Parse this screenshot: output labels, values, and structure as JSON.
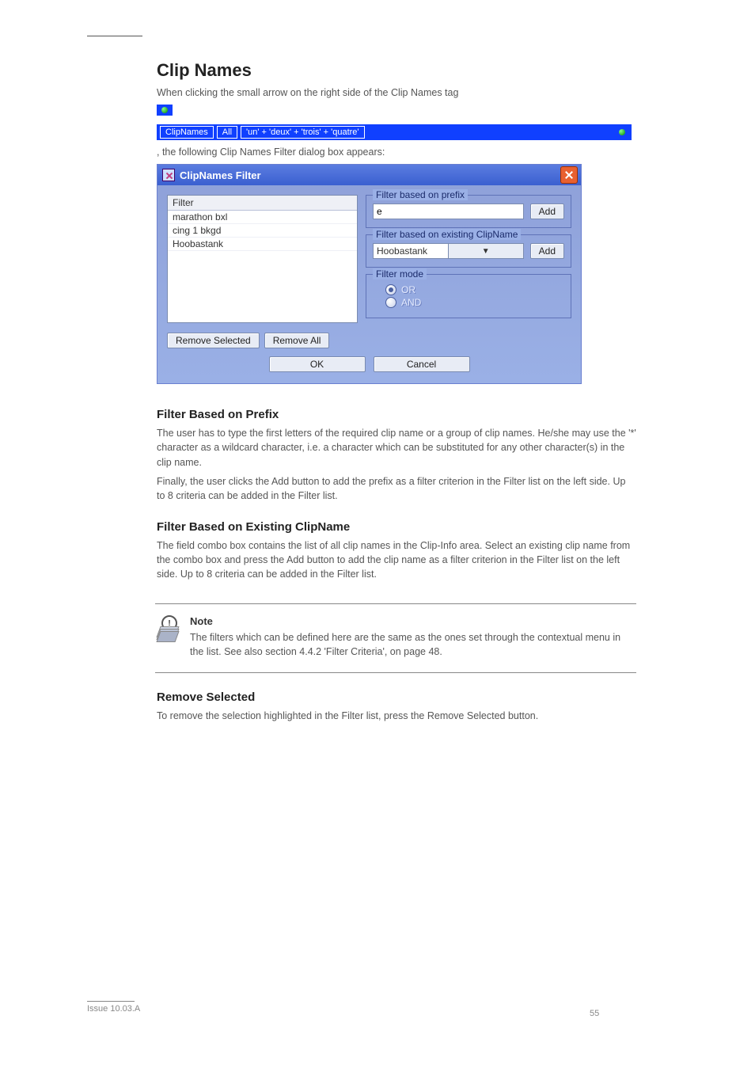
{
  "section_title": "Clip Names",
  "section_desc": "When clicking the small arrow on the right side of the Clip Names tag",
  "bar": {
    "chip1": "ClipNames",
    "chip2": "All",
    "chip3": "'un' + 'deux' + 'trois' + 'quatre'"
  },
  "bar_desc": ", the following Clip Names Filter dialog box appears:",
  "dialog": {
    "title": "ClipNames Filter",
    "grid_header": "Filter",
    "grid_rows": [
      "marathon bxl",
      "cing 1 bkgd",
      "Hoobastank"
    ],
    "remove_selected": "Remove Selected",
    "remove_all": "Remove All",
    "ok": "OK",
    "cancel": "Cancel",
    "prefix_legend": "Filter based on prefix",
    "prefix_value": "e",
    "prefix_add": "Add",
    "existing_legend": "Filter based on existing ClipName",
    "existing_value": "Hoobastank",
    "existing_add": "Add",
    "mode_legend": "Filter mode",
    "mode_or": "OR",
    "mode_and": "AND"
  },
  "prefix": {
    "heading": "Filter Based on Prefix",
    "p1": "The user has to type the first letters of the required clip name or a group of clip names. He/she may use the '*' character as a wildcard character, i.e. a character which can be substituted for any other character(s) in the clip name.",
    "p2": "Finally, the user clicks the Add button to add the prefix as a filter criterion in the Filter list on the left side. Up to 8 criteria can be added in the Filter list."
  },
  "existing": {
    "heading": "Filter Based on Existing ClipName",
    "p1": "The field combo box contains the list of all clip names in the Clip-Info area. Select an existing clip name from the combo box and press the Add button to add the clip name as a filter criterion in the Filter list on the left side. Up to 8 criteria can be added in the Filter list."
  },
  "note": {
    "label": "Note",
    "text": "The filters which can be defined here are the same as the ones set through the contextual menu in the list. See also section 4.4.2 'Filter Criteria', on page 48."
  },
  "remove": {
    "heading": "Remove Selected",
    "p1": "To remove the selection highlighted in the Filter list, press the Remove Selected button."
  },
  "footer": {
    "line1": "Issue 10.03.A",
    "line2": "55"
  }
}
